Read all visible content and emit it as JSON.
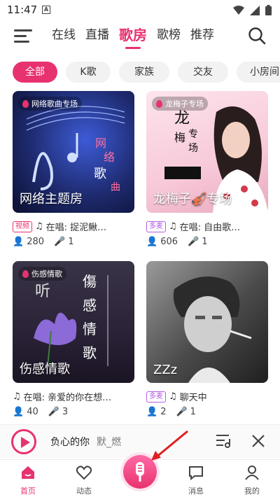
{
  "status": {
    "time": "11:47"
  },
  "nav": {
    "tabs": [
      {
        "label": "在线",
        "active": false
      },
      {
        "label": "直播",
        "active": false
      },
      {
        "label": "歌房",
        "active": true
      },
      {
        "label": "歌榜",
        "active": false
      },
      {
        "label": "推荐",
        "active": false
      }
    ]
  },
  "chips": [
    "全部",
    "K歌",
    "家族",
    "交友",
    "小房间"
  ],
  "rooms": [
    {
      "tag": "网络歌曲专场",
      "cover_title": "网络主题房",
      "badge": "视频",
      "badge_type": "video",
      "now_playing": "在唱: 捉泥鳅…",
      "listeners": "280",
      "singers": "1",
      "theme": "#1e2a6e"
    },
    {
      "tag": "龙梅子专场",
      "cover_title": "龙梅子🎻专场",
      "badge": "多麦",
      "badge_type": "multi",
      "now_playing": "在唱: 自由歌…",
      "listeners": "606",
      "singers": "1",
      "theme": "#f7c9d8"
    },
    {
      "tag": "伤感情歌",
      "cover_title": "伤感情歌",
      "badge": "",
      "badge_type": "",
      "now_playing": "在唱: 亲爱的你在想…",
      "listeners": "40",
      "singers": "3",
      "theme": "#2a2236"
    },
    {
      "tag": "",
      "cover_title": "ZZz",
      "badge": "多麦",
      "badge_type": "multi",
      "now_playing": "聊天中",
      "listeners": "2",
      "singers": "1",
      "theme": "#4a4a4a"
    }
  ],
  "player": {
    "song": "负心的你",
    "singer": "默_燃"
  },
  "bottom_nav": [
    {
      "label": "首页",
      "icon": "home-icon",
      "active": true
    },
    {
      "label": "动态",
      "icon": "heart-icon",
      "active": false
    },
    {
      "label": "消息",
      "icon": "message-icon",
      "active": false
    },
    {
      "label": "我的",
      "icon": "profile-icon",
      "active": false
    }
  ],
  "colors": {
    "accent": "#e8326f",
    "multi_badge": "#b25ce6"
  }
}
